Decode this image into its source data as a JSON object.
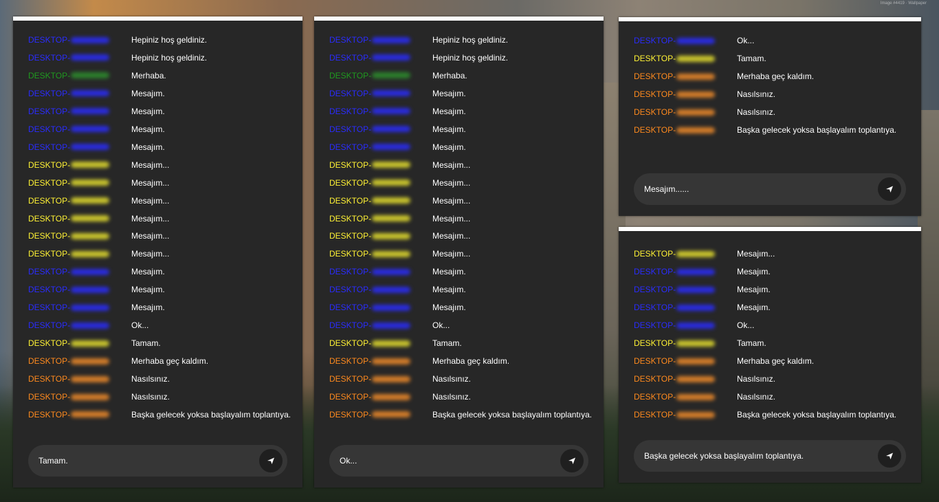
{
  "watermark": "Image #4419 · Wallpaper",
  "colors": {
    "blue": "#2a2cff",
    "green": "#1f9a1f",
    "yellow": "#fff234",
    "orange": "#ff8a1e"
  },
  "user_prefix": "DESKTOP-",
  "panels": [
    {
      "input_value": "Tamam.",
      "messages": [
        {
          "color": "blue",
          "text": "Hepiniz hoş geldiniz."
        },
        {
          "color": "blue",
          "text": "Hepiniz hoş geldiniz."
        },
        {
          "color": "green",
          "text": "Merhaba."
        },
        {
          "color": "blue",
          "text": "Mesajım."
        },
        {
          "color": "blue",
          "text": "Mesajım."
        },
        {
          "color": "blue",
          "text": "Mesajım."
        },
        {
          "color": "blue",
          "text": "Mesajım."
        },
        {
          "color": "yellow",
          "text": "Mesajım..."
        },
        {
          "color": "yellow",
          "text": "Mesajım..."
        },
        {
          "color": "yellow",
          "text": "Mesajım..."
        },
        {
          "color": "yellow",
          "text": "Mesajım..."
        },
        {
          "color": "yellow",
          "text": "Mesajım..."
        },
        {
          "color": "yellow",
          "text": "Mesajım..."
        },
        {
          "color": "blue",
          "text": "Mesajım."
        },
        {
          "color": "blue",
          "text": "Mesajım."
        },
        {
          "color": "blue",
          "text": "Mesajım."
        },
        {
          "color": "blue",
          "text": "Ok..."
        },
        {
          "color": "yellow",
          "text": "Tamam."
        },
        {
          "color": "orange",
          "text": "Merhaba geç kaldım."
        },
        {
          "color": "orange",
          "text": "Nasılsınız."
        },
        {
          "color": "orange",
          "text": "Nasılsınız."
        },
        {
          "color": "orange",
          "text": "Başka gelecek yoksa başlayalım toplantıya."
        }
      ]
    },
    {
      "input_value": "Ok...",
      "messages": [
        {
          "color": "blue",
          "text": "Hepiniz hoş geldiniz."
        },
        {
          "color": "blue",
          "text": "Hepiniz hoş geldiniz."
        },
        {
          "color": "green",
          "text": "Merhaba."
        },
        {
          "color": "blue",
          "text": "Mesajım."
        },
        {
          "color": "blue",
          "text": "Mesajım."
        },
        {
          "color": "blue",
          "text": "Mesajım."
        },
        {
          "color": "blue",
          "text": "Mesajım."
        },
        {
          "color": "yellow",
          "text": "Mesajım..."
        },
        {
          "color": "yellow",
          "text": "Mesajım..."
        },
        {
          "color": "yellow",
          "text": "Mesajım..."
        },
        {
          "color": "yellow",
          "text": "Mesajım..."
        },
        {
          "color": "yellow",
          "text": "Mesajım..."
        },
        {
          "color": "yellow",
          "text": "Mesajım..."
        },
        {
          "color": "blue",
          "text": "Mesajım."
        },
        {
          "color": "blue",
          "text": "Mesajım."
        },
        {
          "color": "blue",
          "text": "Mesajım."
        },
        {
          "color": "blue",
          "text": "Ok..."
        },
        {
          "color": "yellow",
          "text": "Tamam."
        },
        {
          "color": "orange",
          "text": "Merhaba geç kaldım."
        },
        {
          "color": "orange",
          "text": "Nasılsınız."
        },
        {
          "color": "orange",
          "text": "Nasılsınız."
        },
        {
          "color": "orange",
          "text": "Başka gelecek yoksa başlayalım toplantıya."
        }
      ]
    },
    {
      "input_value": "Mesajım......",
      "messages": [
        {
          "color": "blue",
          "text": "Ok..."
        },
        {
          "color": "yellow",
          "text": "Tamam."
        },
        {
          "color": "orange",
          "text": "Merhaba geç kaldım."
        },
        {
          "color": "orange",
          "text": "Nasılsınız."
        },
        {
          "color": "orange",
          "text": "Nasılsınız."
        },
        {
          "color": "orange",
          "text": "Başka gelecek yoksa başlayalım toplantıya."
        }
      ]
    },
    {
      "input_value": "Başka gelecek yoksa başlayalım toplantıya.",
      "messages": [
        {
          "color": "yellow",
          "text": "Mesajım..."
        },
        {
          "color": "blue",
          "text": "Mesajım."
        },
        {
          "color": "blue",
          "text": "Mesajım."
        },
        {
          "color": "blue",
          "text": "Mesajım."
        },
        {
          "color": "blue",
          "text": "Ok..."
        },
        {
          "color": "yellow",
          "text": "Tamam."
        },
        {
          "color": "orange",
          "text": "Merhaba geç kaldım."
        },
        {
          "color": "orange",
          "text": "Nasılsınız."
        },
        {
          "color": "orange",
          "text": "Nasılsınız."
        },
        {
          "color": "orange",
          "text": "Başka gelecek yoksa başlayalım toplantıya."
        }
      ]
    }
  ]
}
